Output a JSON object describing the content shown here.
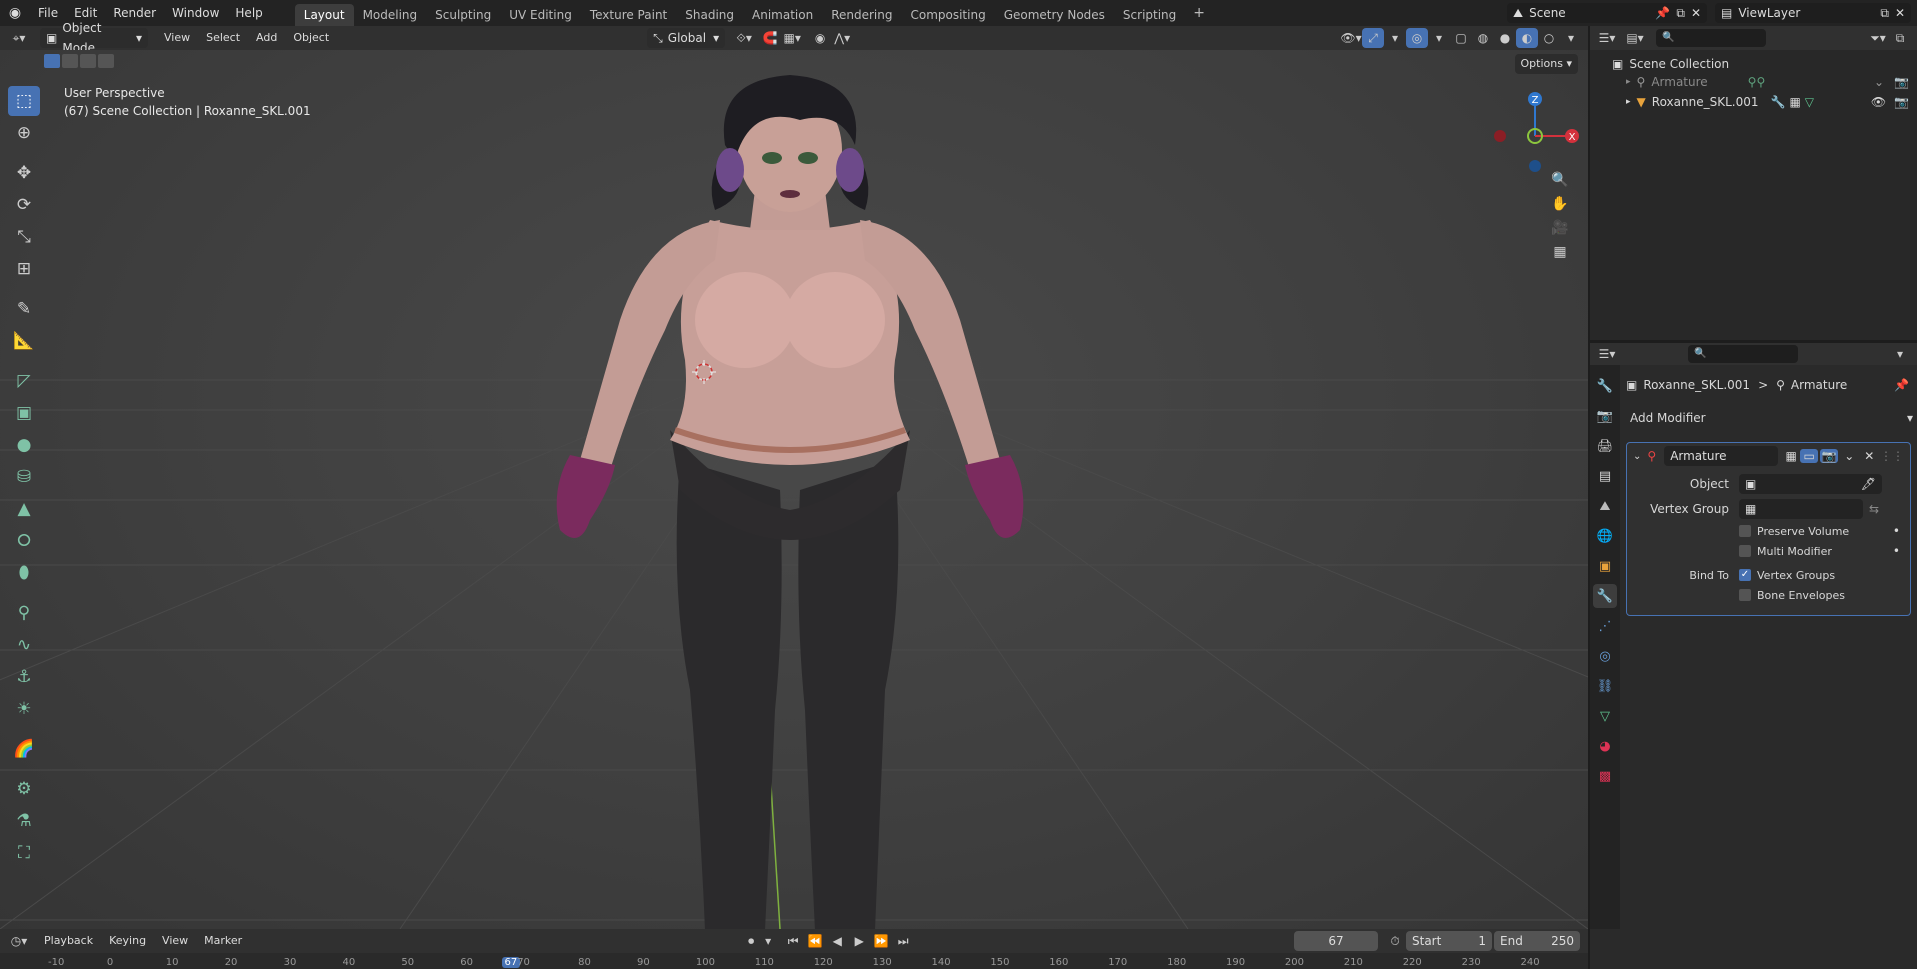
{
  "topbar": {
    "menus": [
      "File",
      "Edit",
      "Render",
      "Window",
      "Help"
    ],
    "workspaces": [
      "Layout",
      "Modeling",
      "Sculpting",
      "UV Editing",
      "Texture Paint",
      "Shading",
      "Animation",
      "Rendering",
      "Compositing",
      "Geometry Nodes",
      "Scripting"
    ],
    "active_workspace": "Layout",
    "add_tab": "+",
    "scene": "Scene",
    "view_layer": "ViewLayer"
  },
  "viewport_header": {
    "mode": "Object Mode",
    "menus": [
      "View",
      "Select",
      "Add",
      "Object"
    ],
    "orientation": "Global",
    "options": "Options"
  },
  "viewport": {
    "perspective": "User Perspective",
    "collection_info": "(67) Scene Collection | Roxanne_SKL.001",
    "gizmo": {
      "z": "Z",
      "x": "X"
    }
  },
  "outliner": {
    "title": "Scene Collection",
    "items": [
      {
        "label": "Armature",
        "dim": true
      },
      {
        "label": "Roxanne_SKL.001",
        "dim": false
      }
    ]
  },
  "properties": {
    "breadcrumb_object": "Roxanne_SKL.001",
    "breadcrumb_sep": ">",
    "breadcrumb_modifier": "Armature",
    "add_modifier": "Add Modifier",
    "modifier": {
      "name": "Armature",
      "object_label": "Object",
      "object_value": "",
      "vertex_group_label": "Vertex Group",
      "vertex_group_value": "",
      "preserve_volume": "Preserve Volume",
      "multi_modifier": "Multi Modifier",
      "bind_to_label": "Bind To",
      "vertex_groups": "Vertex Groups",
      "vertex_groups_checked": true,
      "bone_envelopes": "Bone Envelopes",
      "bone_envelopes_checked": false
    }
  },
  "timeline": {
    "menus": [
      "Playback",
      "Keying",
      "View",
      "Marker"
    ],
    "current_frame": "67",
    "start_label": "Start",
    "start": "1",
    "end_label": "End",
    "end": "250",
    "ticks": [
      "-10",
      "0",
      "10",
      "20",
      "30",
      "40",
      "50",
      "60",
      "67",
      "70",
      "80",
      "90",
      "100",
      "110",
      "120",
      "130",
      "140",
      "150",
      "160",
      "170",
      "180",
      "190",
      "200",
      "210",
      "220",
      "230",
      "240"
    ]
  },
  "colors": {
    "accent": "#4772b3",
    "x_axis": "#d3313c",
    "y_axis": "#8cc63e",
    "z_axis": "#2f78d0"
  }
}
